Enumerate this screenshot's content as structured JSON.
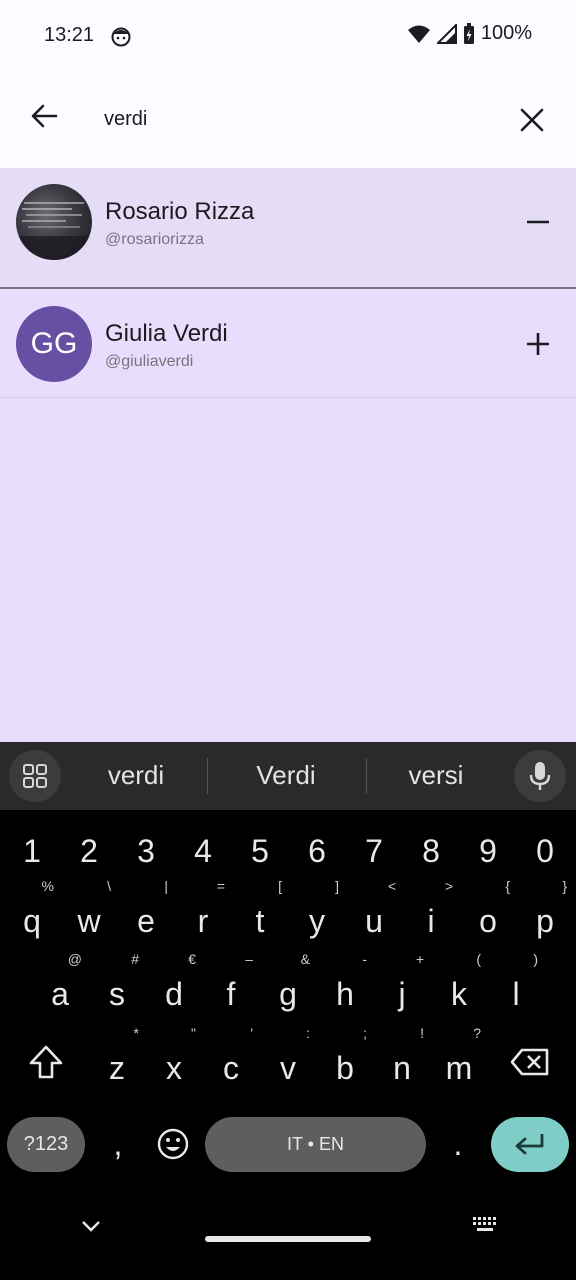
{
  "status_bar": {
    "time": "13:21",
    "battery": "100%"
  },
  "search": {
    "value": "verdi"
  },
  "results": [
    {
      "name": "Rosario Rizza",
      "handle": "@rosariorizza",
      "action": "remove"
    },
    {
      "name": "Giulia Verdi",
      "handle": "@giuliaverdi",
      "initials": "GG",
      "action": "add"
    }
  ],
  "keyboard": {
    "suggestions": [
      "verdi",
      "Verdi",
      "versi"
    ],
    "number_row": [
      "1",
      "2",
      "3",
      "4",
      "5",
      "6",
      "7",
      "8",
      "9",
      "0"
    ],
    "row1": [
      {
        "k": "q",
        "a": "%"
      },
      {
        "k": "w",
        "a": "\\"
      },
      {
        "k": "e",
        "a": "|"
      },
      {
        "k": "r",
        "a": "="
      },
      {
        "k": "t",
        "a": "["
      },
      {
        "k": "y",
        "a": "]"
      },
      {
        "k": "u",
        "a": "<"
      },
      {
        "k": "i",
        "a": ">"
      },
      {
        "k": "o",
        "a": "{"
      },
      {
        "k": "p",
        "a": "}"
      }
    ],
    "row2": [
      {
        "k": "a",
        "a": "@"
      },
      {
        "k": "s",
        "a": "#"
      },
      {
        "k": "d",
        "a": "€"
      },
      {
        "k": "f",
        "a": "–"
      },
      {
        "k": "g",
        "a": "&"
      },
      {
        "k": "h",
        "a": "-"
      },
      {
        "k": "j",
        "a": "+"
      },
      {
        "k": "k",
        "a": "("
      },
      {
        "k": "l",
        "a": ")"
      }
    ],
    "row3": [
      {
        "k": "z",
        "a": "*"
      },
      {
        "k": "x",
        "a": "\""
      },
      {
        "k": "c",
        "a": "'"
      },
      {
        "k": "v",
        "a": ":"
      },
      {
        "k": "b",
        "a": ";"
      },
      {
        "k": "n",
        "a": "!"
      },
      {
        "k": "m",
        "a": "?"
      }
    ],
    "symbols_key": "?123",
    "comma_key": ",",
    "space_label": "IT • EN",
    "period_key": "."
  },
  "colors": {
    "accent": "#6750a4",
    "list_bg": "#e8ddfc",
    "enter_key": "#7fcdc7"
  }
}
